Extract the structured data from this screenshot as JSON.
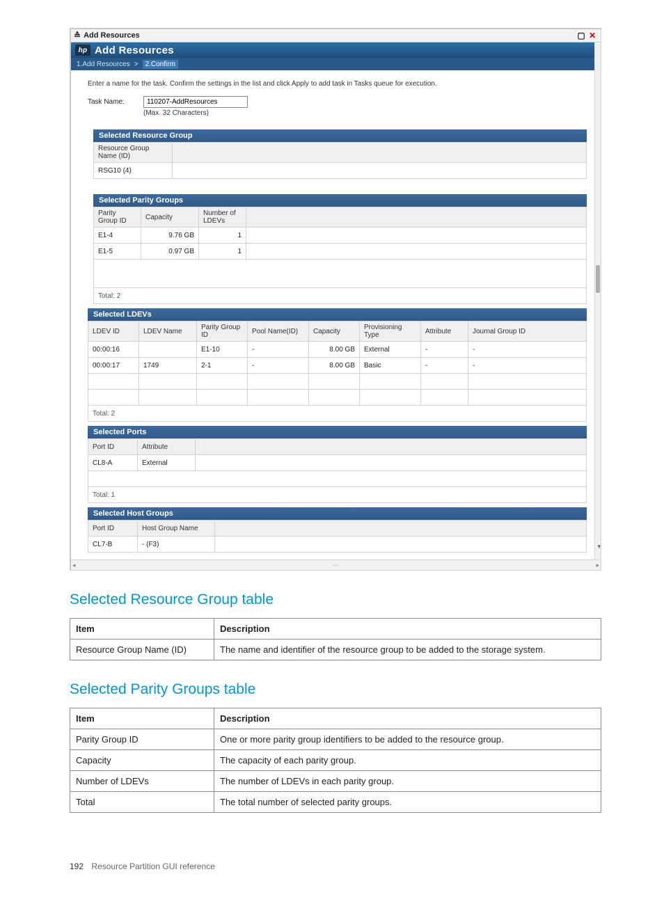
{
  "window": {
    "title": "Add Resources",
    "banner_label": "Add Resources",
    "logo_glyph": "hp",
    "breadcrumb": {
      "step1": "1.Add Resources",
      "sep": ">",
      "step2": "2.Confirm"
    },
    "instruction": "Enter a name for the task. Confirm the settings in the list and click Apply to add task in Tasks queue for execution.",
    "task_name_label": "Task Name:",
    "task_name_value": "110207-AddResources",
    "task_name_hint": "(Max. 32 Characters)"
  },
  "sections": {
    "resource_group": {
      "title": "Selected Resource Group",
      "headers": [
        "Resource Group Name (ID)"
      ],
      "rows": [
        [
          "RSG10 (4)"
        ]
      ]
    },
    "parity_groups": {
      "title": "Selected Parity Groups",
      "headers": [
        "Parity Group ID",
        "Capacity",
        "Number of LDEVs"
      ],
      "rows": [
        [
          "E1-4",
          "9.76 GB",
          "1"
        ],
        [
          "E1-5",
          "0.97 GB",
          "1"
        ]
      ],
      "total_label": "Total:  2"
    },
    "ldevs": {
      "title": "Selected LDEVs",
      "headers": [
        "LDEV ID",
        "LDEV Name",
        "Parity Group ID",
        "Pool Name(ID)",
        "Capacity",
        "Provisioning Type",
        "Attribute",
        "Journal Group ID"
      ],
      "rows": [
        [
          "00:00:16",
          "",
          "E1-10",
          "-",
          "8.00 GB",
          "External",
          "-",
          "-"
        ],
        [
          "00:00:17",
          "1749",
          "2-1",
          "-",
          "8.00 GB",
          "Basic",
          "-",
          "-"
        ]
      ],
      "total_label": "Total:  2"
    },
    "ports": {
      "title": "Selected Ports",
      "headers": [
        "Port ID",
        "Attribute"
      ],
      "rows": [
        [
          "CL8-A",
          "External"
        ]
      ],
      "total_label": "Total:  1"
    },
    "host_groups": {
      "title": "Selected Host Groups",
      "headers": [
        "Port ID",
        "Host Group Name"
      ],
      "rows": [
        [
          "CL7-B",
          "- (F3)"
        ]
      ]
    }
  },
  "doc": {
    "heading1": "Selected Resource Group table",
    "table1": {
      "headers": [
        "Item",
        "Description"
      ],
      "rows": [
        [
          "Resource Group Name (ID)",
          "The name and identifier of the resource group to be added to the storage system."
        ]
      ]
    },
    "heading2": "Selected Parity Groups table",
    "table2": {
      "headers": [
        "Item",
        "Description"
      ],
      "rows": [
        [
          "Parity Group ID",
          "One or more parity group identifiers to be added to the resource group."
        ],
        [
          "Capacity",
          "The capacity of each parity group."
        ],
        [
          "Number of LDEVs",
          "The number of LDEVs in each parity group."
        ],
        [
          "Total",
          "The total number of selected parity groups."
        ]
      ]
    }
  },
  "footer": {
    "page_number": "192",
    "section_title": "Resource Partition GUI reference"
  }
}
